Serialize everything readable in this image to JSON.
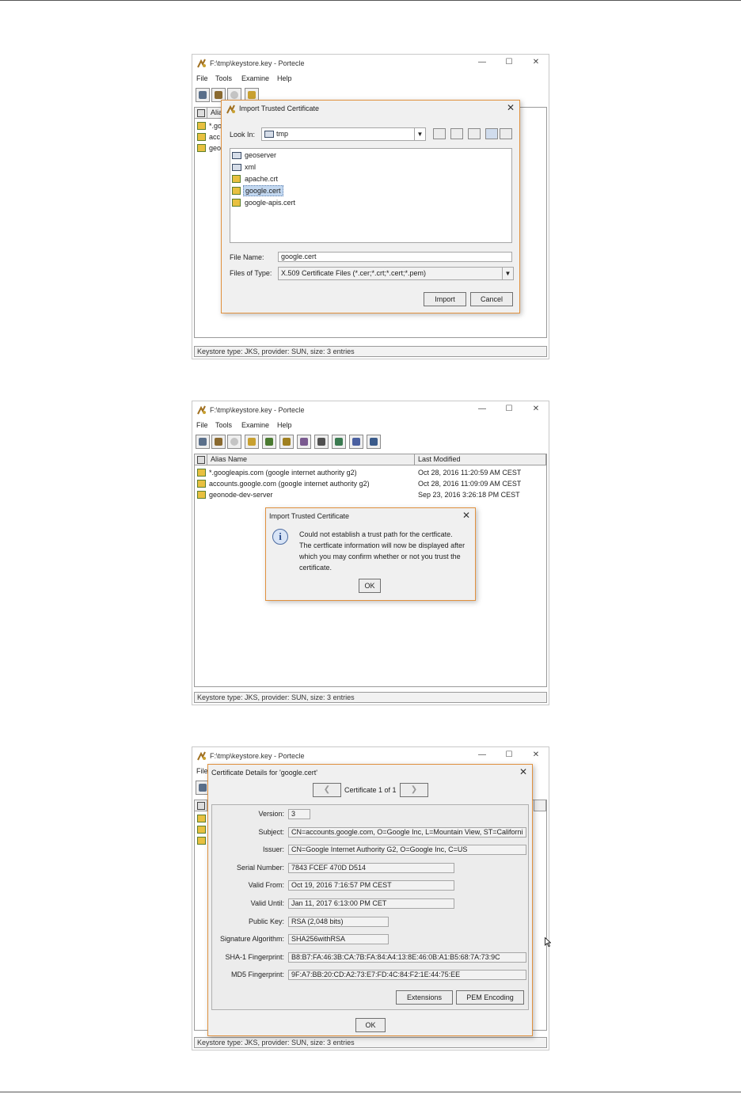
{
  "window": {
    "title": "F:\\tmp\\keystore.key - Portecle",
    "controls": [
      "—",
      "☐",
      "✕"
    ],
    "menu": [
      "File",
      "Tools",
      "Examine",
      "Help"
    ],
    "status": "Keystore type: JKS, provider: SUN, size: 3 entries"
  },
  "table": {
    "columns": [
      "Alias Name",
      "Last Modified"
    ],
    "rows": [
      {
        "alias": "*.googleapis.com (google internet authority g2)",
        "modified": "Oct 28, 2016 11:20:59 AM CEST"
      },
      {
        "alias": "accounts.google.com (google internet authority g2)",
        "modified": "Oct 28, 2016 11:09:09 AM CEST"
      },
      {
        "alias": "geonode-dev-server",
        "modified": "Sep 23, 2016 3:26:18 PM CEST"
      }
    ],
    "partial_aliases": [
      "*.go",
      "acc",
      "geo"
    ],
    "partial_header": "Alias"
  },
  "import_dialog": {
    "title": "Import Trusted Certificate",
    "look_in_label": "Look In:",
    "look_in_value": "tmp",
    "files": [
      {
        "name": "geoserver",
        "type": "folder"
      },
      {
        "name": "xml",
        "type": "folder"
      },
      {
        "name": "apache.crt",
        "type": "cert"
      },
      {
        "name": "google.cert",
        "type": "cert"
      },
      {
        "name": "google-apis.cert",
        "type": "cert"
      }
    ],
    "file_name_label": "File Name:",
    "file_name_value": "google.cert",
    "files_of_type_label": "Files of Type:",
    "files_of_type_value": "X.509 Certificate Files (*.cer;*.crt;*.cert;*.pem)",
    "import_button": "Import",
    "cancel_button": "Cancel"
  },
  "message_dialog": {
    "title": "Import Trusted Certificate",
    "lines": [
      "Could not establish a trust path for the certficate.",
      "The certficate information will now be displayed after",
      "which you may confirm whether or not you trust the",
      "certificate."
    ],
    "ok_button": "OK"
  },
  "details_dialog": {
    "title": "Certificate Details for 'google.cert'",
    "nav_label": "Certificate 1 of 1",
    "fields": [
      {
        "label": "Version:",
        "value": "3"
      },
      {
        "label": "Subject:",
        "value": "CN=accounts.google.com, O=Google Inc, L=Mountain View, ST=Californi"
      },
      {
        "label": "Issuer:",
        "value": "CN=Google Internet Authority G2, O=Google Inc, C=US"
      },
      {
        "label": "Serial Number:",
        "value": "7843 FCEF 470D D514"
      },
      {
        "label": "Valid From:",
        "value": "Oct 19, 2016 7:16:57 PM CEST"
      },
      {
        "label": "Valid Until:",
        "value": "Jan 11, 2017 6:13:00 PM CET"
      },
      {
        "label": "Public Key:",
        "value": "RSA (2,048 bits)"
      },
      {
        "label": "Signature Algorithm:",
        "value": "SHA256withRSA"
      },
      {
        "label": "SHA-1 Fingerprint:",
        "value": "B8:B7:FA:46:3B:CA:7B:FA:84:A4:13:8E:46:0B:A1:B5:68:7A:73:9C"
      },
      {
        "label": "MD5 Fingerprint:",
        "value": "9F:A7:BB:20:CD:A2:73:E7:FD:4C:84:F2:1E:44:75:EE"
      }
    ],
    "extensions_button": "Extensions",
    "pem_button": "PEM Encoding",
    "ok_button": "OK",
    "partial_menu": "File"
  },
  "colors": {
    "dialog_border": "#e0913e",
    "selection": "#c3d8f0",
    "cert_icon": "#e8c040"
  }
}
